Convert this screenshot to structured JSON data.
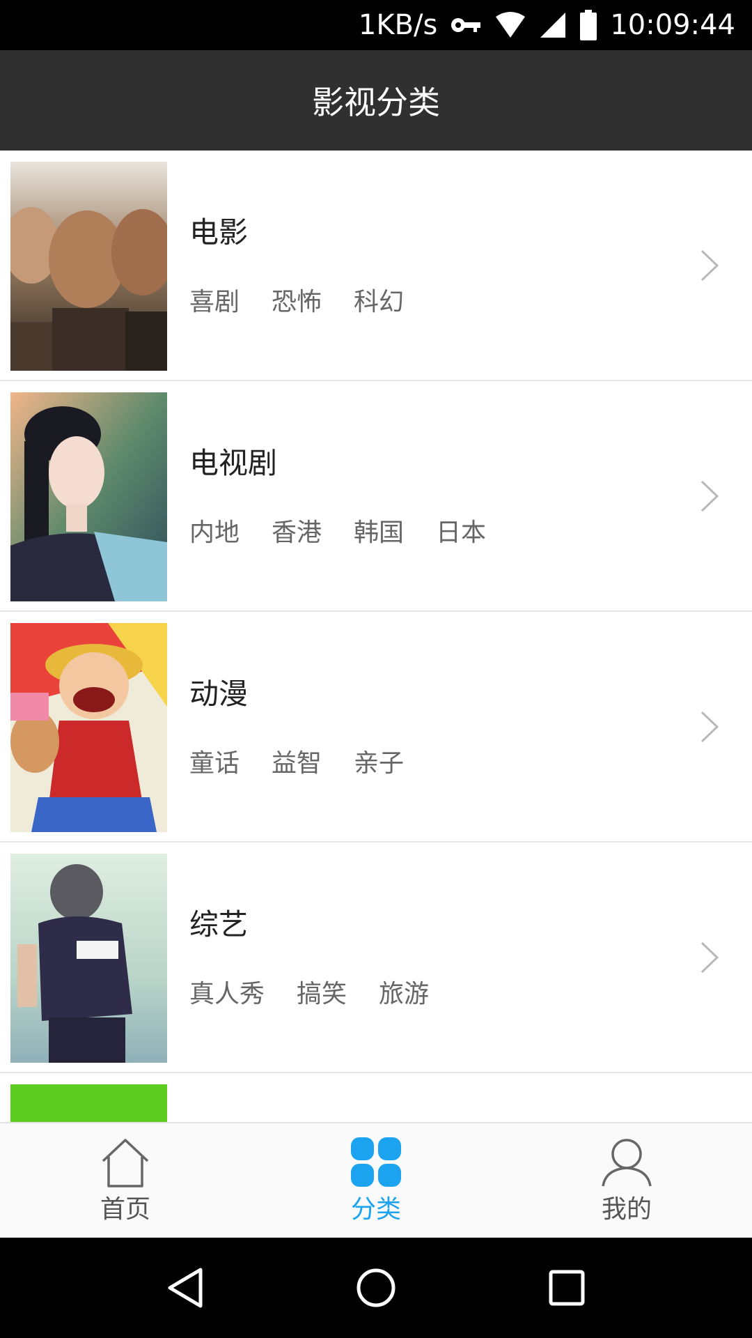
{
  "status_bar": {
    "network_speed": "1KB/s",
    "time": "10:09:44",
    "icons": [
      "vpn-key-icon",
      "wifi-icon",
      "cell-signal-icon",
      "battery-icon"
    ]
  },
  "app_bar": {
    "title": "影视分类"
  },
  "categories": [
    {
      "title": "电影",
      "tags": [
        "喜剧",
        "恐怖",
        "科幻"
      ],
      "thumb": "movie-poster-thumbnail"
    },
    {
      "title": "电视剧",
      "tags": [
        "内地",
        "香港",
        "韩国",
        "日本"
      ],
      "thumb": "tv-drama-poster-thumbnail"
    },
    {
      "title": "动漫",
      "tags": [
        "童话",
        "益智",
        "亲子"
      ],
      "thumb": "anime-poster-thumbnail"
    },
    {
      "title": "综艺",
      "tags": [
        "真人秀",
        "搞笑",
        "旅游"
      ],
      "thumb": "variety-show-poster-thumbnail"
    }
  ],
  "bottom_nav": {
    "items": [
      {
        "label": "首页",
        "icon": "home-icon",
        "active": false
      },
      {
        "label": "分类",
        "icon": "grid-icon",
        "active": true
      },
      {
        "label": "我的",
        "icon": "person-icon",
        "active": false
      }
    ]
  },
  "system_nav": {
    "icons": [
      "back-triangle-icon",
      "home-circle-icon",
      "recents-square-icon"
    ]
  },
  "colors": {
    "status_bar_bg": "#000000",
    "app_bar_bg": "#303030",
    "active_tab": "#1ba3f0",
    "inactive_tab": "#555555",
    "partial_thumb": "#5ccc1e"
  }
}
